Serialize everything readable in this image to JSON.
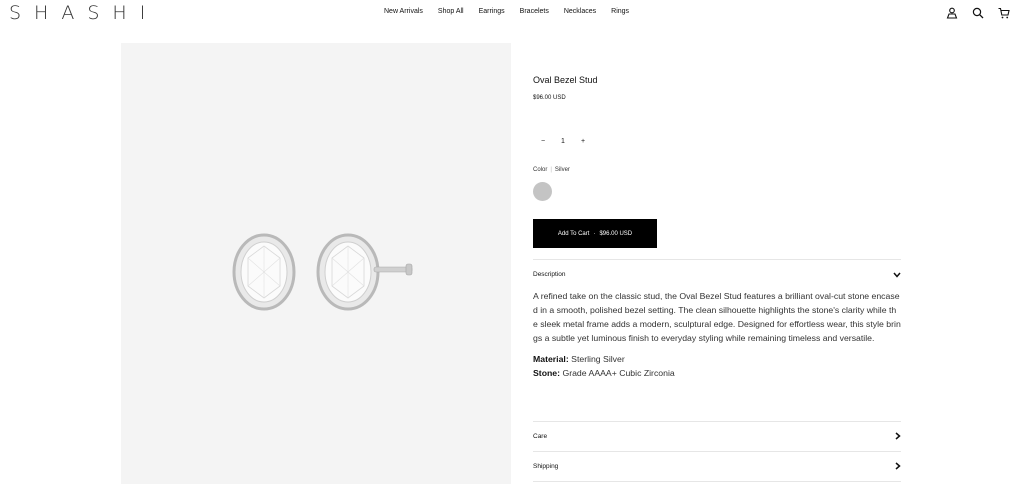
{
  "brand": "SHASHI",
  "nav": [
    "New Arrivals",
    "Shop All",
    "Earrings",
    "Bracelets",
    "Necklaces",
    "Rings"
  ],
  "icons": [
    "account-icon",
    "search-icon",
    "cart-icon"
  ],
  "product": {
    "title": "Oval Bezel Stud",
    "price": "$96.00 USD",
    "qty_minus": "−",
    "qty_value": "1",
    "qty_plus": "+",
    "color_label": "Color",
    "color_value": "Silver",
    "add_to_cart": "Add To Cart",
    "cart_sep": "·",
    "cart_price": "$96.00 USD"
  },
  "description": {
    "label": "Description",
    "body": "A refined take on the classic stud, the Oval Bezel Stud features a brilliant oval-cut stone encased in a smooth, polished bezel setting. The clean silhouette highlights the stone's clarity while the sleek metal frame adds a modern, sculptural edge. Designed for effortless wear, this style brings a subtle yet luminous finish to everyday styling while remaining timeless and versatile.",
    "material_label": "Material:",
    "material_value": "Sterling Silver",
    "stone_label": "Stone:",
    "stone_value": "Grade AAAA+ Cubic Zirconia"
  },
  "care": {
    "label": "Care"
  },
  "shipping": {
    "label": "Shipping"
  },
  "colors": {
    "swatch": "#c4c4c4",
    "button": "#000000"
  }
}
